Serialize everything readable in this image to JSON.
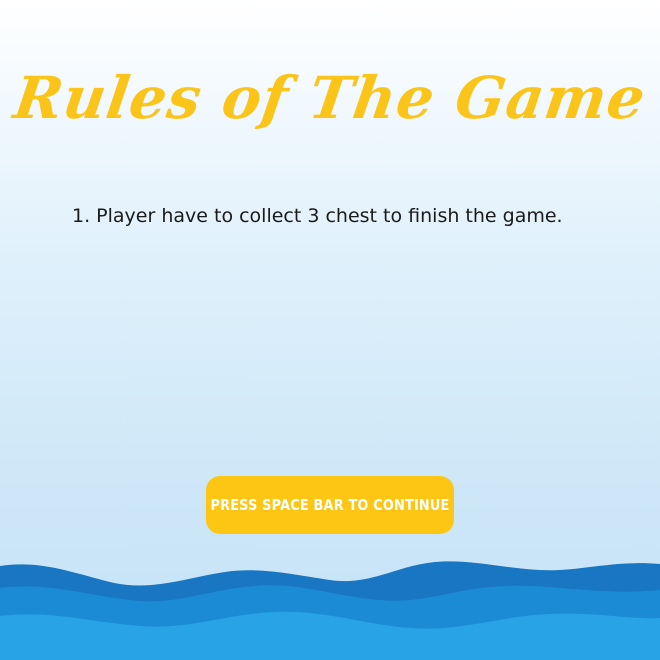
{
  "title": "Rules of The Game",
  "rules": [
    "1. Player have to collect 3 chest to finish the game."
  ],
  "continue_button": {
    "label": "PRESS SPACE BAR TO CONTINUE"
  },
  "colors": {
    "accent": "#fbc419",
    "button": "#fdc614",
    "button_text": "#ffffff",
    "wave_dark": "#1976c2",
    "wave_mid": "#1c8bd6",
    "wave_light": "#27a3e6"
  }
}
